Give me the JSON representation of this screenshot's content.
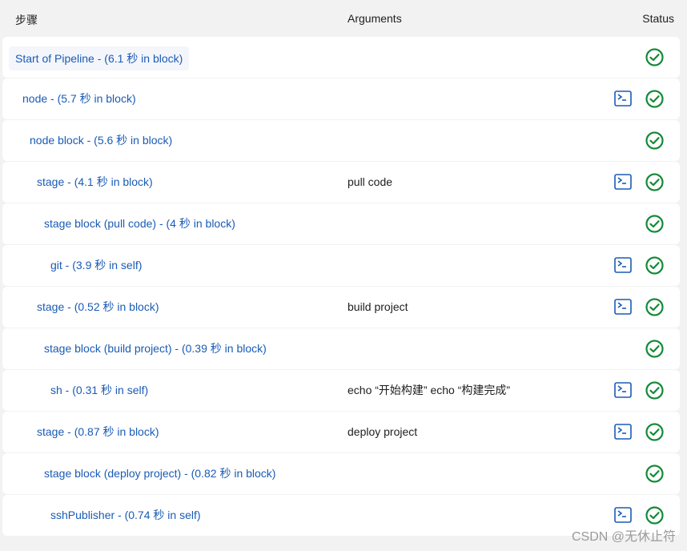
{
  "header": {
    "step_label": "步骤",
    "arguments_label": "Arguments",
    "status_label": "Status"
  },
  "rows": [
    {
      "step": "Start of Pipeline - (6.1 秒 in block)",
      "args": "",
      "console": false,
      "status": "success",
      "indent": 0
    },
    {
      "step": "node - (5.7 秒 in block)",
      "args": "",
      "console": true,
      "status": "success",
      "indent": 1
    },
    {
      "step": "node block - (5.6 秒 in block)",
      "args": "",
      "console": false,
      "status": "success",
      "indent": 2
    },
    {
      "step": "stage - (4.1 秒 in block)",
      "args": "pull code",
      "console": true,
      "status": "success",
      "indent": 3
    },
    {
      "step": "stage block (pull code) - (4 秒 in block)",
      "args": "",
      "console": false,
      "status": "success",
      "indent": 4
    },
    {
      "step": "git - (3.9 秒 in self)",
      "args": "",
      "console": true,
      "status": "success",
      "indent": 5
    },
    {
      "step": "stage - (0.52 秒 in block)",
      "args": "build project",
      "console": true,
      "status": "success",
      "indent": 3
    },
    {
      "step": "stage block (build project) - (0.39 秒 in block)",
      "args": "",
      "console": false,
      "status": "success",
      "indent": 4
    },
    {
      "step": "sh - (0.31 秒 in self)",
      "args": "echo “开始构建” echo “构建完成”",
      "console": true,
      "status": "success",
      "indent": 5
    },
    {
      "step": "stage - (0.87 秒 in block)",
      "args": "deploy project",
      "console": true,
      "status": "success",
      "indent": 3
    },
    {
      "step": "stage block (deploy project) - (0.82 秒 in block)",
      "args": "",
      "console": false,
      "status": "success",
      "indent": 4
    },
    {
      "step": "sshPublisher - (0.74 秒 in self)",
      "args": "",
      "console": true,
      "status": "success",
      "indent": 5
    }
  ],
  "colors": {
    "link": "#1a5bb5",
    "success": "#138a36",
    "console_icon": "#1a5bb5"
  },
  "icons": {
    "console": "terminal-icon",
    "status": "check-circle-icon"
  },
  "watermark": "CSDN @无休止符"
}
